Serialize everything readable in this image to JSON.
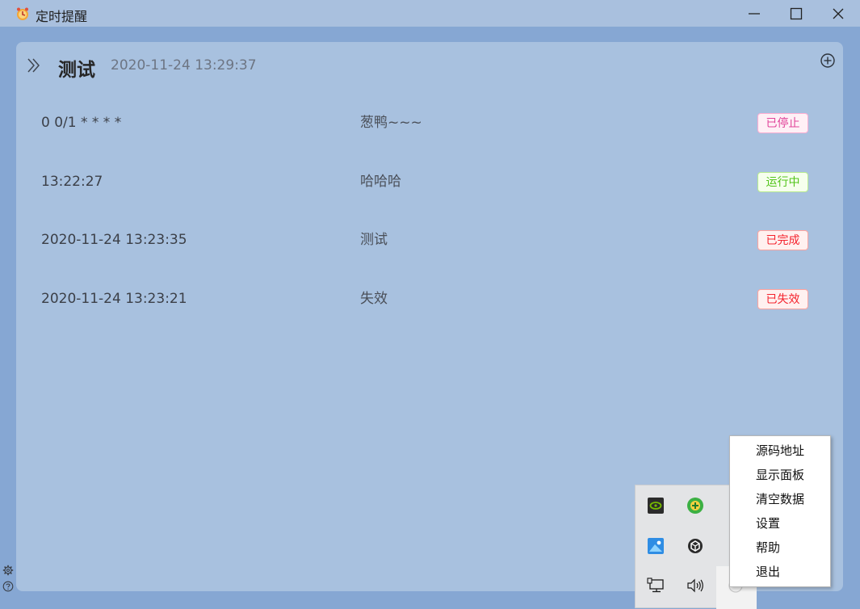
{
  "window": {
    "title": "定时提醒",
    "app_icon": "alarm-clock-icon",
    "controls": [
      "minimize-icon",
      "maximize-icon",
      "close-icon"
    ]
  },
  "panel": {
    "expand_icon": "double-chevron-right-icon",
    "title": "测试",
    "time": "2020-11-24 13:29:37",
    "add_icon": "plus-circle-icon"
  },
  "reminders": [
    {
      "trigger": "0 0/1 * * * *",
      "message": "葱鸭~~~",
      "status": "已停止",
      "status_color": "#e0449a"
    },
    {
      "trigger": "13:22:27",
      "message": "哈哈哈",
      "status": "运行中",
      "status_color": "#52c41a"
    },
    {
      "trigger": "2020-11-24 13:23:35",
      "message": "测试",
      "status": "已完成",
      "status_color": "#f5222d"
    },
    {
      "trigger": "2020-11-24 13:23:21",
      "message": "失效",
      "status": "已失效",
      "status_color": "#f5222d"
    }
  ],
  "tray": {
    "icons": [
      "nvidia-icon",
      "add-green-icon",
      "photo-app-icon",
      "unity-icon",
      "network-icon",
      "volume-icon",
      "clock-app-icon"
    ]
  },
  "context_menu": {
    "items": [
      "源码地址",
      "显示面板",
      "清空数据",
      "设置",
      "帮助",
      "退出"
    ]
  },
  "corner": {
    "icons": [
      "settings-gear-icon",
      "help-icon"
    ]
  }
}
